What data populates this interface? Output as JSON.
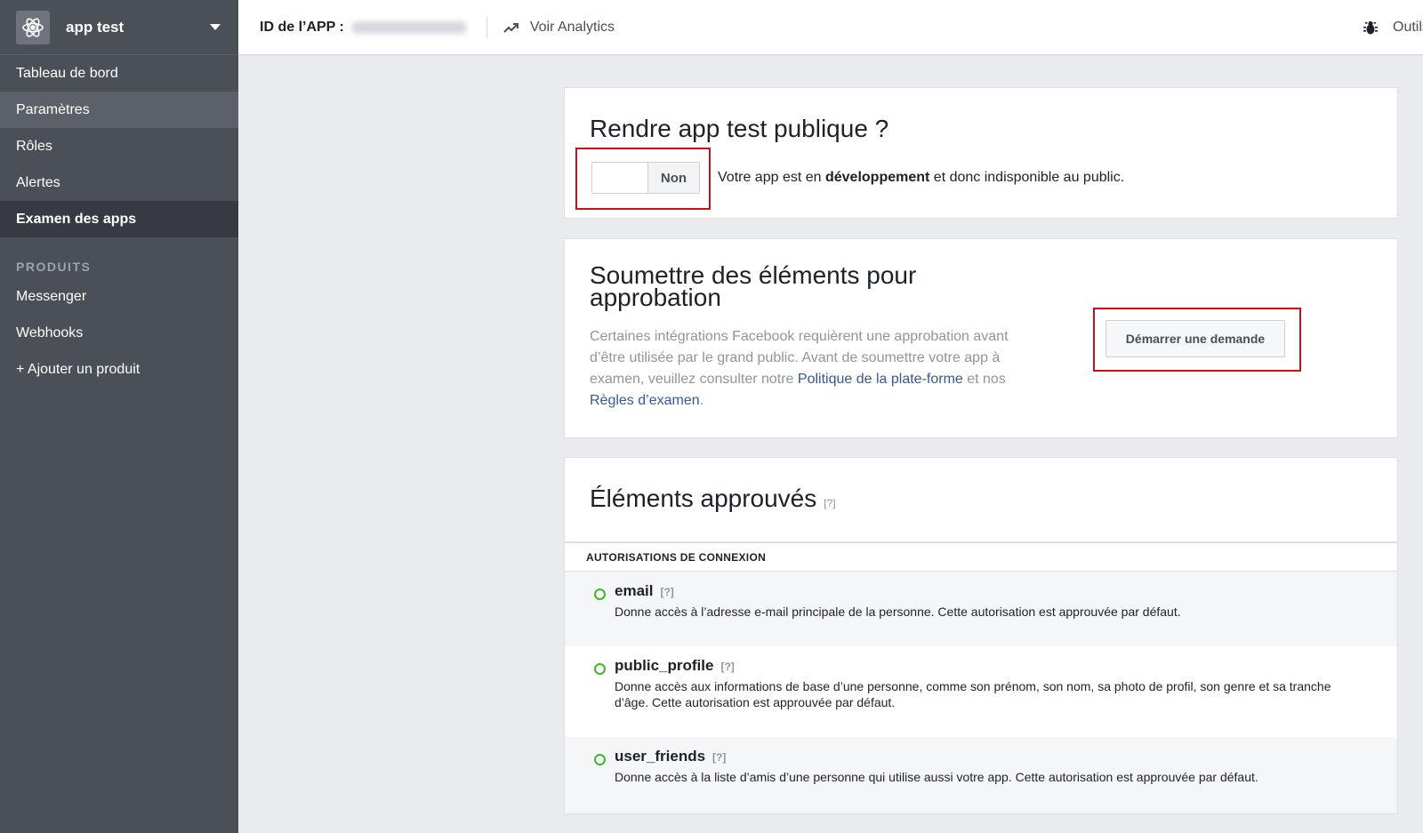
{
  "sidebar": {
    "app_name": "app test",
    "nav": [
      {
        "label": "Tableau de bord"
      },
      {
        "label": "Paramètres"
      },
      {
        "label": "Rôles"
      },
      {
        "label": "Alertes"
      },
      {
        "label": "Examen des apps"
      }
    ],
    "products_heading": "PRODUITS",
    "products": [
      {
        "label": "Messenger"
      },
      {
        "label": "Webhooks"
      },
      {
        "label": "+ Ajouter un produit"
      }
    ]
  },
  "topbar": {
    "app_id_label": "ID de l’APP :",
    "analytics_label": "Voir Analytics",
    "tools_label": "Outils"
  },
  "public_card": {
    "title": "Rendre app test publique ?",
    "toggle_label": "Non",
    "desc_prefix": "Votre app est en ",
    "desc_bold": "développement",
    "desc_suffix": " et donc indisponible au public."
  },
  "submit_card": {
    "title": "Soumettre des éléments pour approbation",
    "desc_part1": "Certaines intégrations Facebook requièrent une approbation avant d’être utilisée par le grand public. Avant de soumettre votre app à examen, veuillez consulter notre ",
    "link1": "Politique de la plate-forme",
    "desc_part2": " et nos ",
    "link2": "Règles d’examen",
    "desc_part3": ".",
    "button_label": "Démarrer une demande"
  },
  "approved_card": {
    "title": "Éléments approuvés",
    "help": "[?]",
    "section_header": "AUTORISATIONS DE CONNEXION",
    "permissions": [
      {
        "name": "email",
        "help": "[?]",
        "desc": "Donne accès à l’adresse e-mail principale de la personne. Cette autorisation est approuvée par défaut."
      },
      {
        "name": "public_profile",
        "help": "[?]",
        "desc": "Donne accès aux informations de base d’une personne, comme son prénom, son nom, sa photo de profil, son genre et sa tranche d’âge. Cette autorisation est approuvée par défaut."
      },
      {
        "name": "user_friends",
        "help": "[?]",
        "desc": "Donne accès à la liste d’amis d’une personne qui utilise aussi votre app. Cette autorisation est approuvée par défaut."
      }
    ]
  },
  "colors": {
    "sidebar_bg": "#4b4f56",
    "sidebar_active": "#373b41",
    "highlight_border": "#c4121b",
    "approved_dot": "#42b72a",
    "link": "#365899"
  }
}
